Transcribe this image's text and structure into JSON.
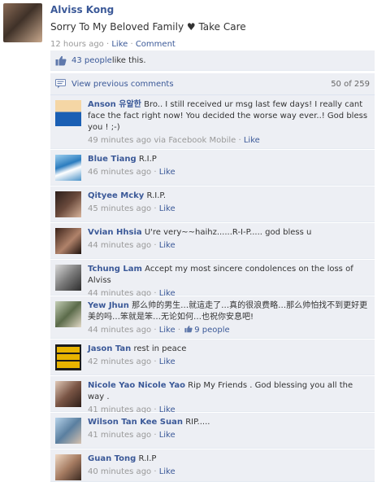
{
  "post": {
    "author": "Alviss Kong",
    "message": "Sorry To My Beloved Family ♥ Take Care",
    "time": "12 hours ago",
    "sep": " · ",
    "like_label": "Like",
    "comment_label": "Comment"
  },
  "likes": {
    "count_link": "43 people",
    "suffix": " like this."
  },
  "view_previous": {
    "label": "View previous comments",
    "count": "50 of 259"
  },
  "comments": [
    {
      "name": "Anson 유알한",
      "text": "Bro.. I still received ur msg last few days! I really cant face the fact right now! You decided the worse way ever..! God bless you ! ;-)",
      "time": "49 minutes ago via Facebook Mobile",
      "like": "Like"
    },
    {
      "name": "Blue Tiang",
      "text": "R.I.P",
      "time": "46 minutes ago",
      "like": "Like"
    },
    {
      "name": "Qityee Mcky",
      "text": "R.I.P.",
      "time": "45 minutes ago",
      "like": "Like"
    },
    {
      "name": "Vvian Hhsia",
      "text": "U're very~~haihz......R-I-P..... god bless u",
      "time": "44 minutes ago",
      "like": "Like"
    },
    {
      "name": "Tchung Lam",
      "text": "Accept my most sincere condolences on the loss of Alviss",
      "time": "44 minutes ago",
      "like": "Like"
    },
    {
      "name": "Yew Jhun",
      "text": "那么帅的男生…就這走了…真的很浪费略…那么帅怕找不到更好更美的吗…笨就是笨…无论如何…也祝你安息吧!",
      "time": "44 minutes ago",
      "like": "Like",
      "likes": "9 people"
    },
    {
      "name": "Jason Tan",
      "text": "rest in peace",
      "time": "42 minutes ago",
      "like": "Like"
    },
    {
      "name": "Nicole Yao Nicole Yao",
      "text": "Rip My Friends . God blessing you all the way .",
      "time": "41 minutes ago",
      "like": "Like"
    },
    {
      "name": "Wilson Tan Kee Suan",
      "text": "RIP.....",
      "time": "41 minutes ago",
      "like": "Like"
    },
    {
      "name": "Guan Tong",
      "text": "R.I.P",
      "time": "40 minutes ago",
      "like": "Like"
    }
  ],
  "colors": {
    "link": "#3b5998",
    "ufi_bg": "#edeff4",
    "meta": "#999999"
  },
  "icons": {
    "like": "thumbs-up-icon",
    "comments": "comment-bubble-icon"
  }
}
